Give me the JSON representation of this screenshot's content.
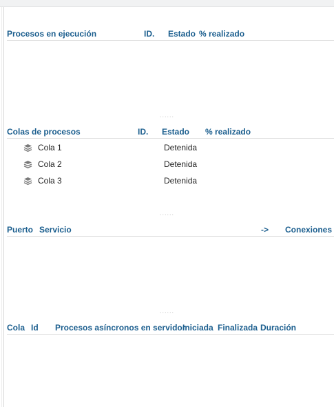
{
  "running": {
    "col_name": "Procesos en ejecución",
    "col_id": "ID.",
    "col_state": "Estado",
    "col_progress": "% realizado"
  },
  "queues": {
    "col_name": "Colas de procesos",
    "col_id": "ID.",
    "col_state": "Estado",
    "col_progress": "% realizado",
    "items": [
      {
        "name": "Cola 1",
        "state": "Detenida"
      },
      {
        "name": "Cola 2",
        "state": "Detenida"
      },
      {
        "name": "Cola 3",
        "state": "Detenida"
      }
    ]
  },
  "ports": {
    "col_port": "Puerto",
    "col_service": "Servicio",
    "col_arrow": "->",
    "col_connections": "Conexiones"
  },
  "async": {
    "col_queue": "Cola",
    "col_id": "Id",
    "col_process": "Procesos asíncronos en servidor",
    "col_started": "Iniciada",
    "col_finished": "Finalizada",
    "col_duration": "Duración"
  },
  "splitter_glyph": "......",
  "icons": {
    "queue": "stack-layers-icon"
  },
  "colors": {
    "header_text": "#1b5e8e",
    "divider": "#dcdcdc",
    "icon": "#7a7a7a"
  }
}
